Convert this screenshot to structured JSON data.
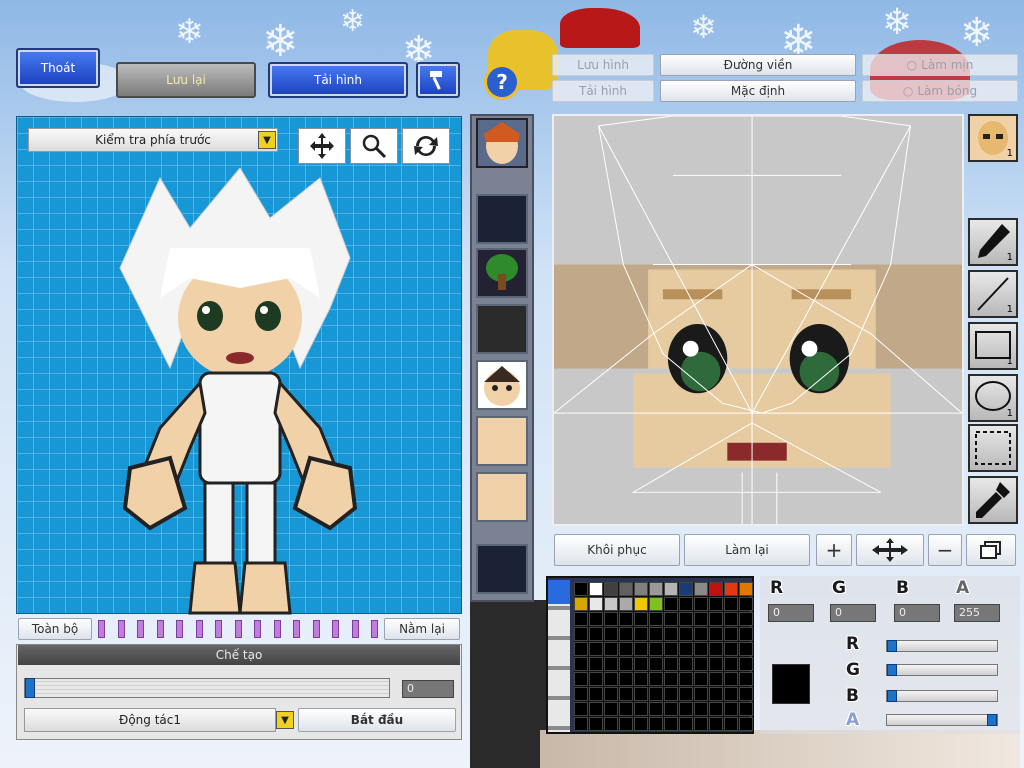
{
  "top_left": {
    "exit_label": "Thoát",
    "save_label": "Lưu lại",
    "reload_label": "Tải hình",
    "hammer_icon": "hammer-icon"
  },
  "preview": {
    "view_select_value": "Kiểm tra phía trước",
    "tools": [
      "move-icon",
      "zoom-icon",
      "rotate-icon"
    ],
    "all_label": "Toàn bộ",
    "lie_label": "Nằm lại",
    "create_header": "Chế tạo",
    "slider_value": "0",
    "action_select_value": "Động tác1",
    "start_label": "Bắt đầu"
  },
  "help_icon": "help-icon",
  "editor": {
    "save_image_label": "Lưu hình",
    "load_image_label": "Tải hình",
    "outline_label": "Đường viền",
    "default_label": "Mặc định",
    "smooth_label": "Làm mịn",
    "shine_label": "Làm bóng",
    "restore_label": "Khôi phục",
    "redo_label": "Làm lại",
    "bottom_tools": [
      "plus-icon",
      "move-icon",
      "minus-icon",
      "window-icon"
    ]
  },
  "side_tools": {
    "face_count": "1",
    "tools": [
      {
        "name": "pen-icon",
        "count": "1"
      },
      {
        "name": "line-icon",
        "count": "1"
      },
      {
        "name": "rectangle-icon",
        "count": "1"
      },
      {
        "name": "ellipse-icon",
        "count": "1"
      },
      {
        "name": "select-icon",
        "count": ""
      },
      {
        "name": "eyedropper-icon",
        "count": ""
      }
    ]
  },
  "palette": {
    "colors": [
      "#000000",
      "#ffffff",
      "#404040",
      "#606060",
      "#808080",
      "#9a9a9a",
      "#b4b4b4",
      "#1a3a7a",
      "#8a8a8a",
      "#c01010",
      "#e03a10",
      "#e07800",
      "#d8a800",
      "#e8e8e8",
      "#c8c8c8",
      "#aaaaaa",
      "#f0c800",
      "#80c020"
    ],
    "current_color": "#000000"
  },
  "color_values": {
    "r_label": "R",
    "g_label": "G",
    "b_label": "B",
    "a_label": "A",
    "r": "0",
    "g": "0",
    "b": "0",
    "a": "255",
    "slider_levels": {
      "r": 0,
      "g": 0,
      "b": 0,
      "a": 1
    }
  }
}
